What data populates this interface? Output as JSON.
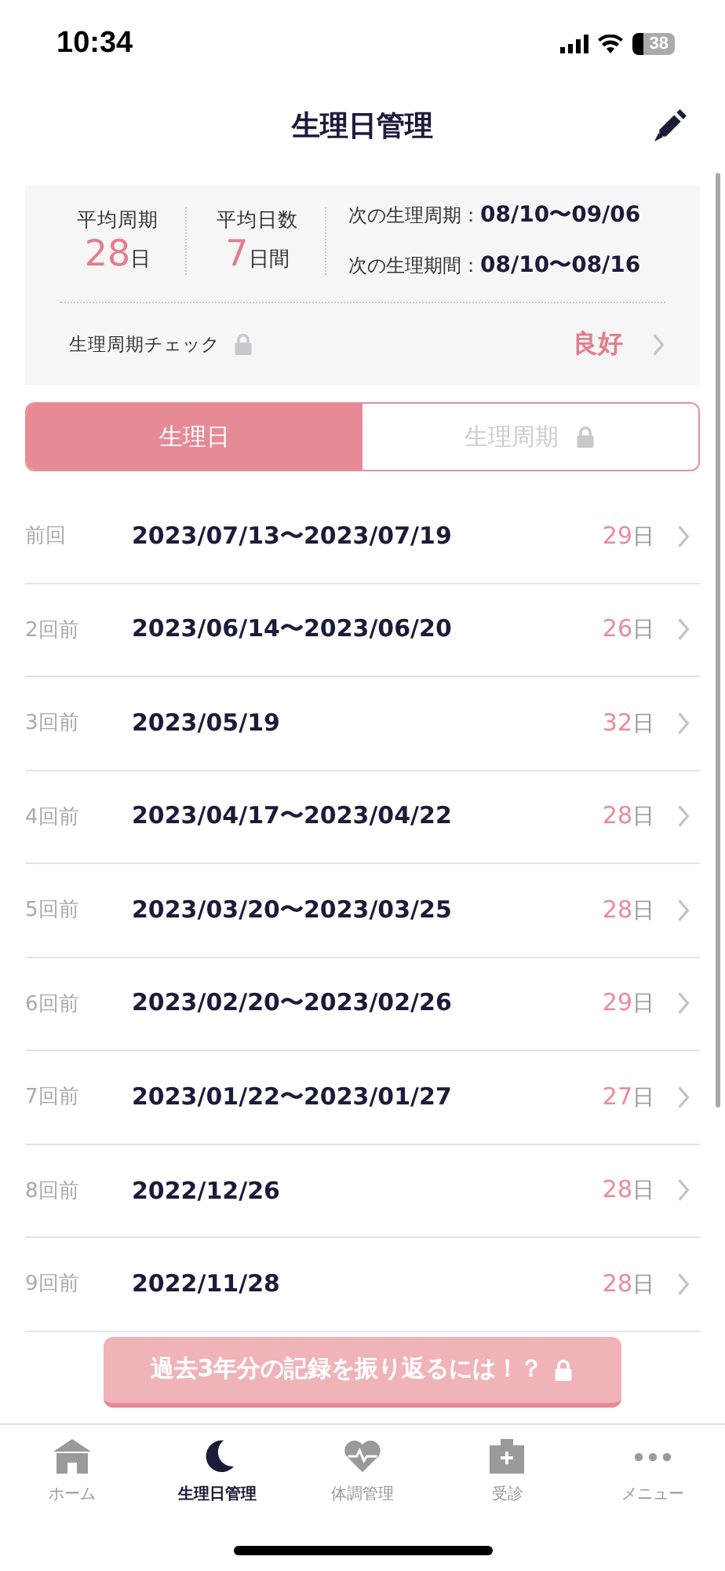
{
  "status_bar": {
    "time": "10:34",
    "battery": "38"
  },
  "header": {
    "title": "生理日管理"
  },
  "summary": {
    "stats": [
      {
        "label": "平均周期",
        "value": "28",
        "unit": "日"
      },
      {
        "label": "平均日数",
        "value": "7",
        "unit": "日間"
      }
    ],
    "forecasts": [
      {
        "label": "次の生理周期：",
        "value": "08/10〜09/06"
      },
      {
        "label": "次の生理期間：",
        "value": "08/10〜08/16"
      }
    ],
    "check": {
      "label": "生理周期チェック",
      "locked": true,
      "result": "良好"
    }
  },
  "tabs": [
    {
      "label": "生理日",
      "selected": true,
      "locked": false
    },
    {
      "label": "生理周期",
      "selected": false,
      "locked": true
    }
  ],
  "records": [
    {
      "label": "前回",
      "dates": "2023/07/13〜2023/07/19",
      "days": "29",
      "unit": "日"
    },
    {
      "label": "2回前",
      "dates": "2023/06/14〜2023/06/20",
      "days": "26",
      "unit": "日"
    },
    {
      "label": "3回前",
      "dates": "2023/05/19",
      "days": "32",
      "unit": "日"
    },
    {
      "label": "4回前",
      "dates": "2023/04/17〜2023/04/22",
      "days": "28",
      "unit": "日"
    },
    {
      "label": "5回前",
      "dates": "2023/03/20〜2023/03/25",
      "days": "28",
      "unit": "日"
    },
    {
      "label": "6回前",
      "dates": "2023/02/20〜2023/02/26",
      "days": "29",
      "unit": "日"
    },
    {
      "label": "7回前",
      "dates": "2023/01/22〜2023/01/27",
      "days": "27",
      "unit": "日"
    },
    {
      "label": "8回前",
      "dates": "2022/12/26",
      "days": "28",
      "unit": "日"
    },
    {
      "label": "9回前",
      "dates": "2022/11/28",
      "days": "28",
      "unit": "日"
    }
  ],
  "promo_button": {
    "label": "過去3年分の記録を振り返るには！？",
    "locked": true
  },
  "tab_bar": [
    {
      "kind": "home",
      "label": "ホーム",
      "selected": false
    },
    {
      "kind": "moon",
      "label": "生理日管理",
      "selected": true
    },
    {
      "kind": "heart",
      "label": "体調管理",
      "selected": false
    },
    {
      "kind": "clinic",
      "label": "受診",
      "selected": false
    },
    {
      "kind": "more",
      "label": "メニュー",
      "selected": false
    }
  ]
}
